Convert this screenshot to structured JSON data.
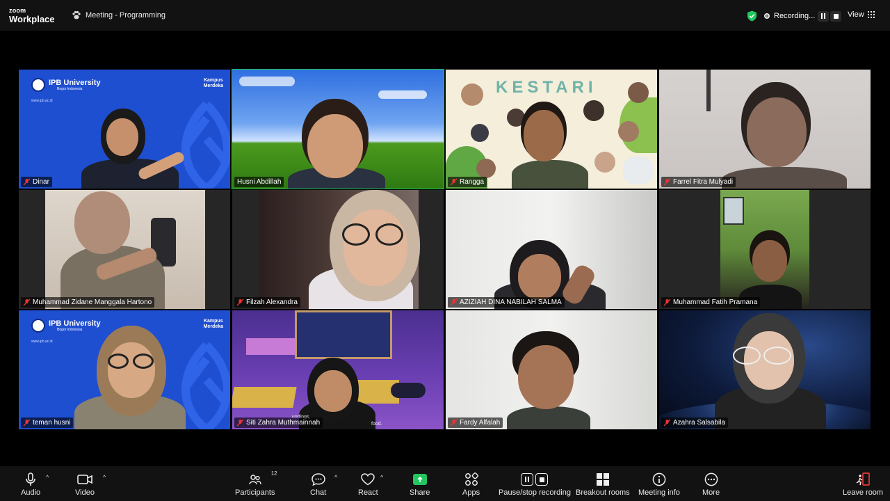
{
  "app": {
    "logo_top": "zoom",
    "logo_bottom": "Workplace"
  },
  "meeting": {
    "title": "Meeting - Programming"
  },
  "recording": {
    "status": "Recording..."
  },
  "view": {
    "label": "View"
  },
  "participants_grid": [
    {
      "name": "Dinar",
      "bg": "ipb",
      "active": false
    },
    {
      "name": "Husni Abdillah",
      "bg": "xp",
      "active": true
    },
    {
      "name": "Rangga",
      "bg": "kestari",
      "active": false
    },
    {
      "name": "Farrel Fitra Mulyadi",
      "bg": "plain-light",
      "active": false
    },
    {
      "name": "Muhammad Zidane Manggala Hartono",
      "bg": "room",
      "active": false
    },
    {
      "name": "Filzah Alexandra",
      "bg": "dark-room",
      "active": false
    },
    {
      "name": "AZIZIAH DINA NABILAH SALMA",
      "bg": "white-wall",
      "active": false
    },
    {
      "name": "Muhammad Fatih Pramana",
      "bg": "green-room",
      "active": false
    },
    {
      "name": "teman husni",
      "bg": "ipb",
      "active": false
    },
    {
      "name": "Siti Zahra Muthmainnah",
      "bg": "purple",
      "active": false
    },
    {
      "name": "Fardy Alfalah",
      "bg": "white-wall",
      "active": false
    },
    {
      "name": "Azahra Salsabila",
      "bg": "space",
      "active": false
    }
  ],
  "ipb_banner": {
    "title": "IPB University",
    "subtitle": "Bogor Indonesia",
    "site": "www.ipb.ac.id",
    "badge_line1": "Kampus",
    "badge_line2": "Merdeka"
  },
  "kestari": {
    "title": "KESTARI"
  },
  "siti_caption": {
    "line1": "...undings,",
    "line2": "food."
  },
  "toolbar": {
    "audio": "Audio",
    "video": "Video",
    "participants": "Participants",
    "participants_count": "12",
    "chat": "Chat",
    "react": "React",
    "share": "Share",
    "apps": "Apps",
    "record": "Pause/stop recording",
    "breakout": "Breakout rooms",
    "info": "Meeting info",
    "more": "More",
    "leave": "Leave room"
  },
  "colors": {
    "accent_green": "#22c55e",
    "ipb_blue": "#1f4fd1",
    "toolbar_bg": "#121212"
  }
}
